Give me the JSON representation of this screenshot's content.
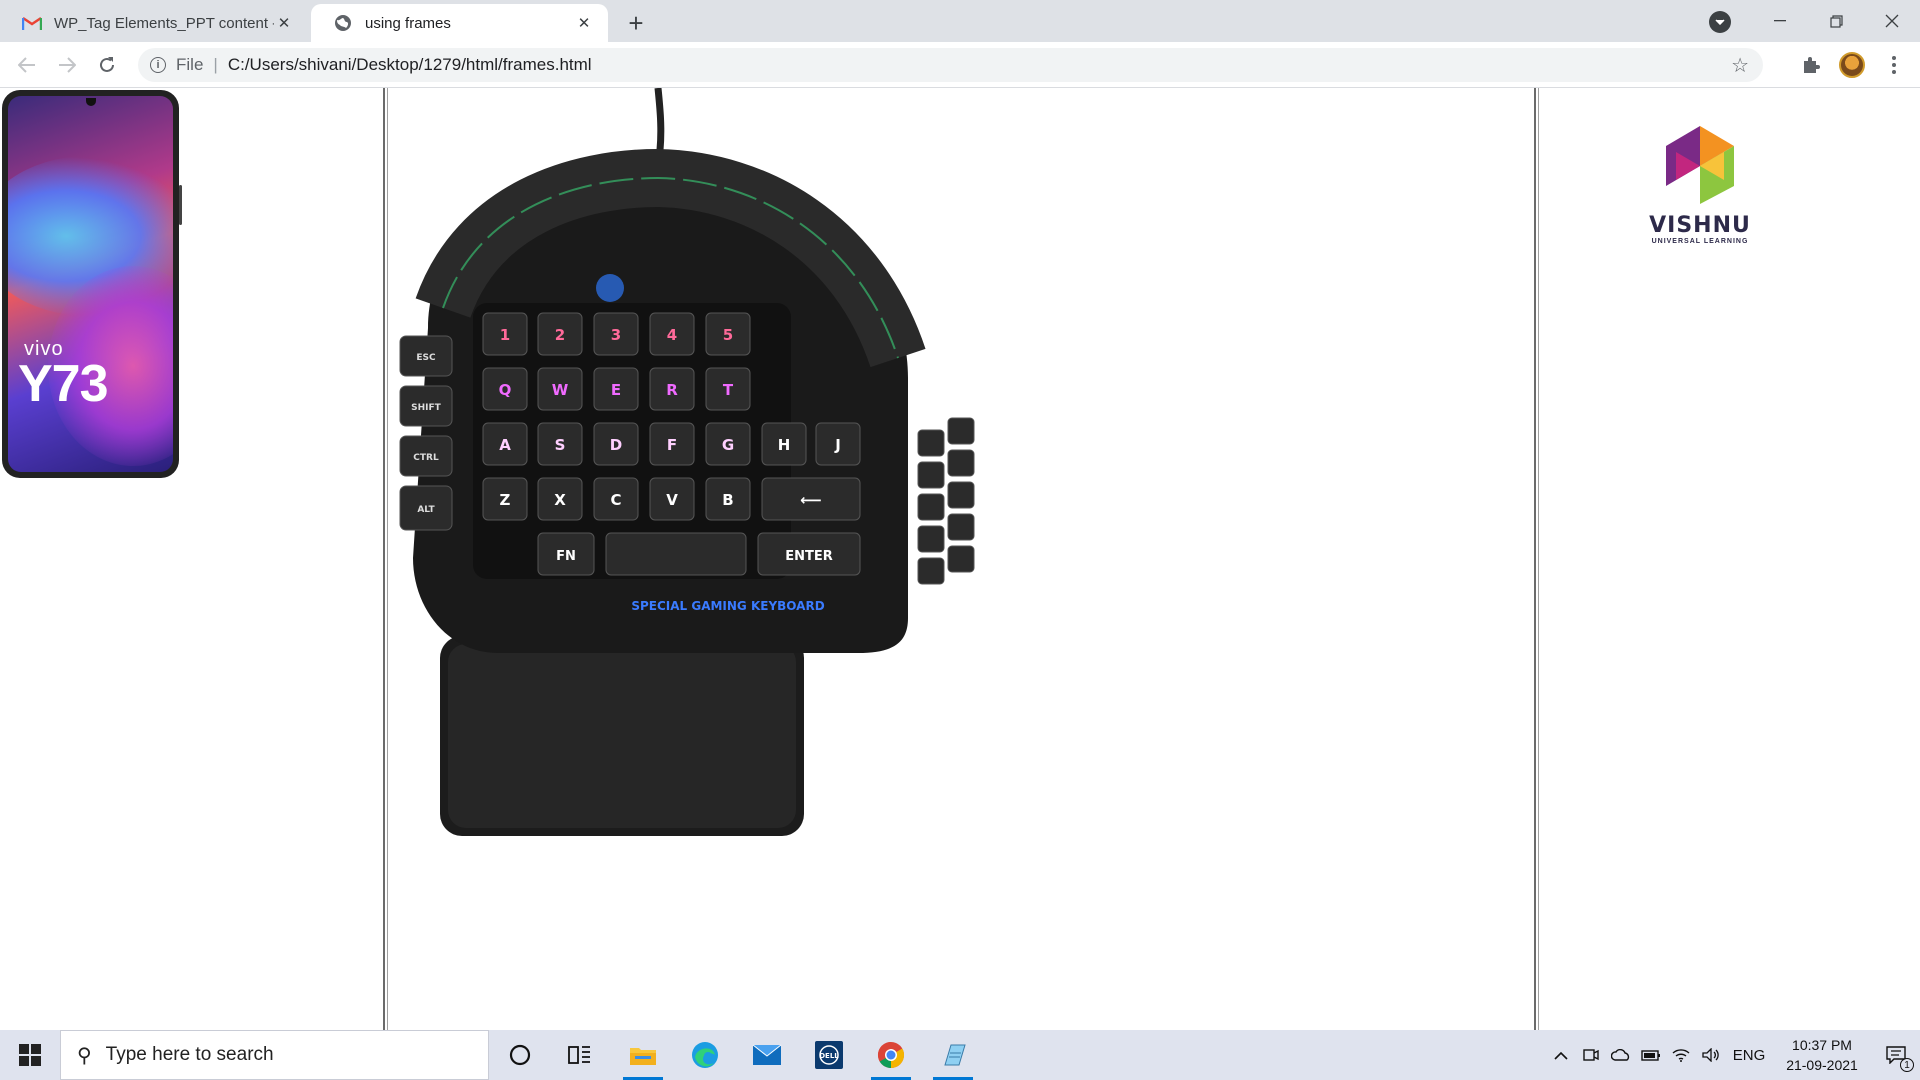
{
  "browser": {
    "tabs": [
      {
        "title": "WP_Tag Elements_PPT content -",
        "icon": "gmail-icon",
        "active": false
      },
      {
        "title": "using frames",
        "icon": "globe-icon",
        "active": true
      }
    ],
    "new_tab_symbol": "+",
    "address": {
      "scheme_label": "File",
      "separator": "|",
      "url": "C:/Users/shivani/Desktop/1279/html/frames.html"
    },
    "window_controls": [
      "minimize-icon",
      "restore-icon",
      "close-icon"
    ]
  },
  "frames": {
    "left": {
      "image": "vivo Y73 phone",
      "brand_text": "vivo",
      "model_text": "Y73"
    },
    "middle": {
      "image": "one-handed gaming keyboard",
      "keyboard_caption": "SPECIAL GAMING KEYBOARD"
    },
    "right": {
      "logo_word": "VISHNU",
      "logo_sub": "UNIVERSAL LEARNING"
    }
  },
  "taskbar": {
    "search_placeholder": "Type here to search",
    "pinned": [
      "cortana-icon",
      "task-view-icon",
      "file-explorer-icon",
      "edge-icon",
      "mail-icon",
      "dell-icon",
      "chrome-icon",
      "notepad-icon"
    ],
    "language": "ENG",
    "time": "10:37 PM",
    "date": "21-09-2021",
    "notification_count": "1"
  },
  "colors": {
    "accent": "#0078d4",
    "tabstrip": "#dee1e6",
    "taskbar": "#dfe3ee"
  }
}
